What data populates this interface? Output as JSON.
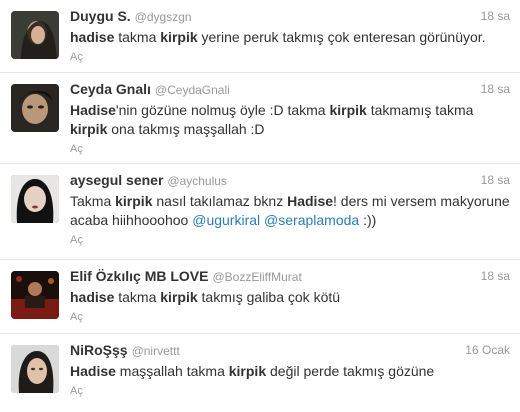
{
  "tweets": [
    {
      "name": "Duygu S.",
      "handle": "@dygszgn",
      "time": "18 sa",
      "segments": [
        {
          "t": "hadise",
          "b": true
        },
        {
          "t": " takma "
        },
        {
          "t": "kirpik",
          "b": true
        },
        {
          "t": " yerine peruk takmış çok enteresan görünüyor."
        }
      ],
      "action": "Aç"
    },
    {
      "name": "Ceyda Gnalı",
      "handle": "@CeydaGnali",
      "time": "18 sa",
      "segments": [
        {
          "t": "Hadise",
          "b": true
        },
        {
          "t": "'nin gözüne nolmuş öyle :D takma "
        },
        {
          "t": "kirpik",
          "b": true
        },
        {
          "t": " takmamış takma "
        },
        {
          "t": "kirpik",
          "b": true
        },
        {
          "t": " ona takmış maşşallah :D"
        }
      ],
      "action": "Aç"
    },
    {
      "name": "aysegul sener",
      "handle": "@aychulus",
      "time": "18 sa",
      "segments": [
        {
          "t": "Takma "
        },
        {
          "t": "kirpik",
          "b": true
        },
        {
          "t": " nasıl takılamaz bknz "
        },
        {
          "t": "Hadise",
          "b": true
        },
        {
          "t": "! ders mi versem makyorune acaba hiihhooohoo "
        },
        {
          "t": "@ugurkiral",
          "m": true
        },
        {
          "t": " "
        },
        {
          "t": "@seraplamoda",
          "m": true
        },
        {
          "t": " :))"
        }
      ],
      "action": "Aç"
    },
    {
      "name": "Elif Özkılıç MB LOVE",
      "handle": "@BozzEliffMurat",
      "time": "18 sa",
      "segments": [
        {
          "t": "hadise",
          "b": true
        },
        {
          "t": " takma "
        },
        {
          "t": "kirpik",
          "b": true
        },
        {
          "t": " takmış galiba çok kötü"
        }
      ],
      "action": "Aç"
    },
    {
      "name": "NiRoŞşş",
      "handle": "@nirvettt",
      "time": "16 Ocak",
      "segments": [
        {
          "t": "Hadise",
          "b": true
        },
        {
          "t": " maşşallah takma "
        },
        {
          "t": "kirpik",
          "b": true
        },
        {
          "t": " değil perde takmış gözüne"
        }
      ],
      "action": "Aç"
    }
  ],
  "colors": {
    "name": "#333333",
    "meta": "#999999",
    "mention": "#2b7bb9",
    "divider": "#e8e8e8"
  }
}
